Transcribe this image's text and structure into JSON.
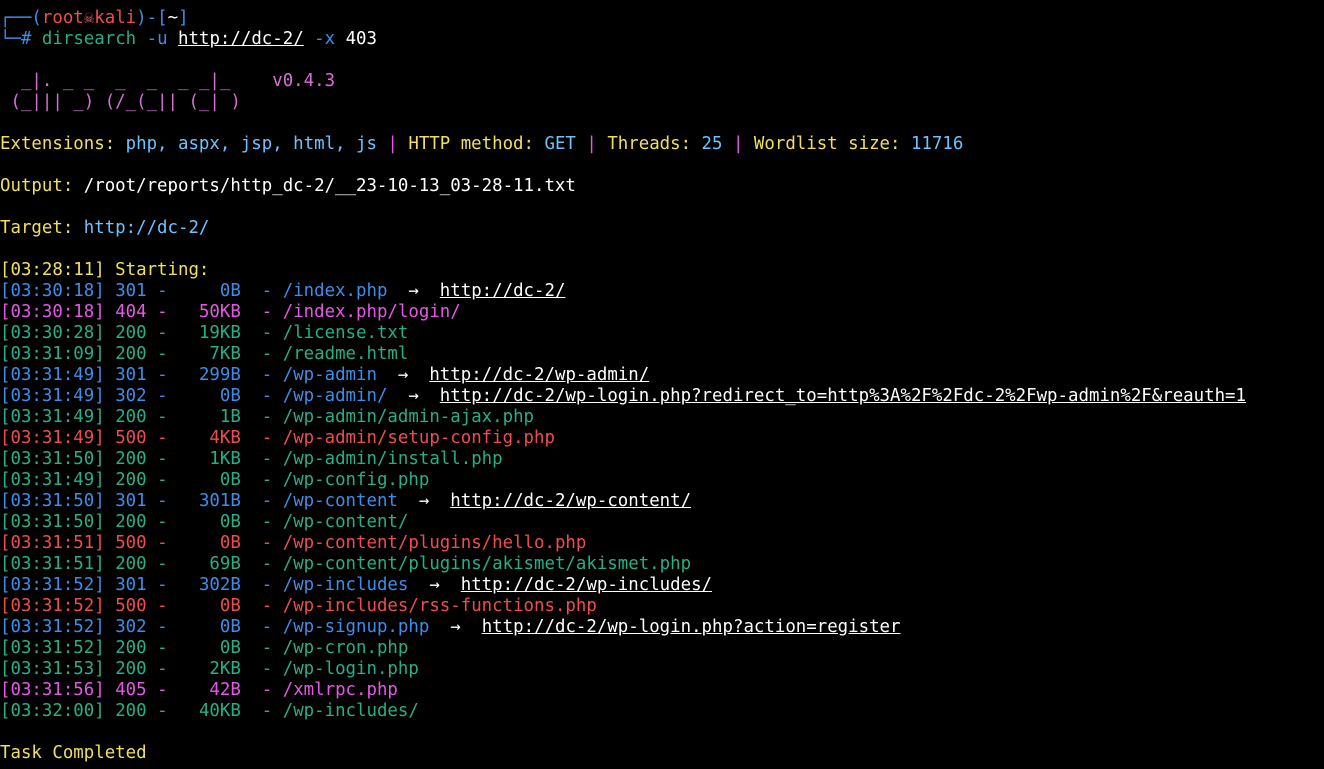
{
  "colors": {
    "background": "#000000",
    "prompt_frame": "#3b8eea",
    "prompt_user": "#e2606e",
    "info_label": "#f1e05a",
    "info_value": "#6ec3ff",
    "status_2xx": "#23b08a",
    "status_3xx": "#3b8eea",
    "status_403_404": "#e558e5",
    "status_5xx": "#f14c4c",
    "banner": "#d670d6"
  },
  "prompt": {
    "frame_top_left": "┌──(",
    "user": "root",
    "skull_icon": "💀",
    "host": "kali",
    "frame_mid": ")-[",
    "cwd": "~",
    "frame_end": "]",
    "frame_bottom": "└─",
    "hash": "# ",
    "command": "dirsearch",
    "flag_u": " -u ",
    "url": "http://dc-2/",
    "flag_x": " -x ",
    "exclude": "403"
  },
  "banner": {
    "line1": "  _|. _ _  _  _  _ _|_    v0.4.3",
    "line2": " (_||| _) (/_(_|| (_| )"
  },
  "info": {
    "extensions_label": "Extensions: ",
    "extensions_value": "php, aspx, jsp, html, js",
    "sep": " | ",
    "method_label": "HTTP method: ",
    "method_value": "GET",
    "threads_label": "Threads: ",
    "threads_value": "25",
    "wordlist_label": "Wordlist size: ",
    "wordlist_value": "11716"
  },
  "output": {
    "label": "Output: ",
    "path": "/root/reports/http_dc-2/__23-10-13_03-28-11.txt"
  },
  "target": {
    "label": "Target: ",
    "url": "http://dc-2/"
  },
  "starting": {
    "time": "[03:28:11]",
    "text": " Starting:"
  },
  "results": [
    {
      "time": "[03:30:18]",
      "code": "301",
      "size": "0B",
      "path": "/index.php",
      "redirect": "http://dc-2/",
      "color": "blue"
    },
    {
      "time": "[03:30:18]",
      "code": "404",
      "size": "50KB",
      "path": "/index.php/login/",
      "redirect": "",
      "color": "pink"
    },
    {
      "time": "[03:30:28]",
      "code": "200",
      "size": "19KB",
      "path": "/license.txt",
      "redirect": "",
      "color": "green"
    },
    {
      "time": "[03:31:09]",
      "code": "200",
      "size": "7KB",
      "path": "/readme.html",
      "redirect": "",
      "color": "green"
    },
    {
      "time": "[03:31:49]",
      "code": "301",
      "size": "299B",
      "path": "/wp-admin",
      "redirect": "http://dc-2/wp-admin/",
      "color": "blue"
    },
    {
      "time": "[03:31:49]",
      "code": "302",
      "size": "0B",
      "path": "/wp-admin/",
      "redirect": "http://dc-2/wp-login.php?redirect_to=http%3A%2F%2Fdc-2%2Fwp-admin%2F&reauth=1",
      "color": "blue"
    },
    {
      "time": "[03:31:49]",
      "code": "200",
      "size": "1B",
      "path": "/wp-admin/admin-ajax.php",
      "redirect": "",
      "color": "green"
    },
    {
      "time": "[03:31:49]",
      "code": "500",
      "size": "4KB",
      "path": "/wp-admin/setup-config.php",
      "redirect": "",
      "color": "red"
    },
    {
      "time": "[03:31:50]",
      "code": "200",
      "size": "1KB",
      "path": "/wp-admin/install.php",
      "redirect": "",
      "color": "green"
    },
    {
      "time": "[03:31:49]",
      "code": "200",
      "size": "0B",
      "path": "/wp-config.php",
      "redirect": "",
      "color": "green"
    },
    {
      "time": "[03:31:50]",
      "code": "301",
      "size": "301B",
      "path": "/wp-content",
      "redirect": "http://dc-2/wp-content/",
      "color": "blue"
    },
    {
      "time": "[03:31:50]",
      "code": "200",
      "size": "0B",
      "path": "/wp-content/",
      "redirect": "",
      "color": "green"
    },
    {
      "time": "[03:31:51]",
      "code": "500",
      "size": "0B",
      "path": "/wp-content/plugins/hello.php",
      "redirect": "",
      "color": "red"
    },
    {
      "time": "[03:31:51]",
      "code": "200",
      "size": "69B",
      "path": "/wp-content/plugins/akismet/akismet.php",
      "redirect": "",
      "color": "green"
    },
    {
      "time": "[03:31:52]",
      "code": "301",
      "size": "302B",
      "path": "/wp-includes",
      "redirect": "http://dc-2/wp-includes/",
      "color": "blue"
    },
    {
      "time": "[03:31:52]",
      "code": "500",
      "size": "0B",
      "path": "/wp-includes/rss-functions.php",
      "redirect": "",
      "color": "red"
    },
    {
      "time": "[03:31:52]",
      "code": "302",
      "size": "0B",
      "path": "/wp-signup.php",
      "redirect": "http://dc-2/wp-login.php?action=register",
      "color": "blue"
    },
    {
      "time": "[03:31:52]",
      "code": "200",
      "size": "0B",
      "path": "/wp-cron.php",
      "redirect": "",
      "color": "green"
    },
    {
      "time": "[03:31:53]",
      "code": "200",
      "size": "2KB",
      "path": "/wp-login.php",
      "redirect": "",
      "color": "green"
    },
    {
      "time": "[03:31:56]",
      "code": "405",
      "size": "42B",
      "path": "/xmlrpc.php",
      "redirect": "",
      "color": "pink"
    },
    {
      "time": "[03:32:00]",
      "code": "200",
      "size": "40KB",
      "path": "/wp-includes/",
      "redirect": "",
      "color": "green"
    }
  ],
  "arrow": "  →  ",
  "task_completed": "Task Completed"
}
